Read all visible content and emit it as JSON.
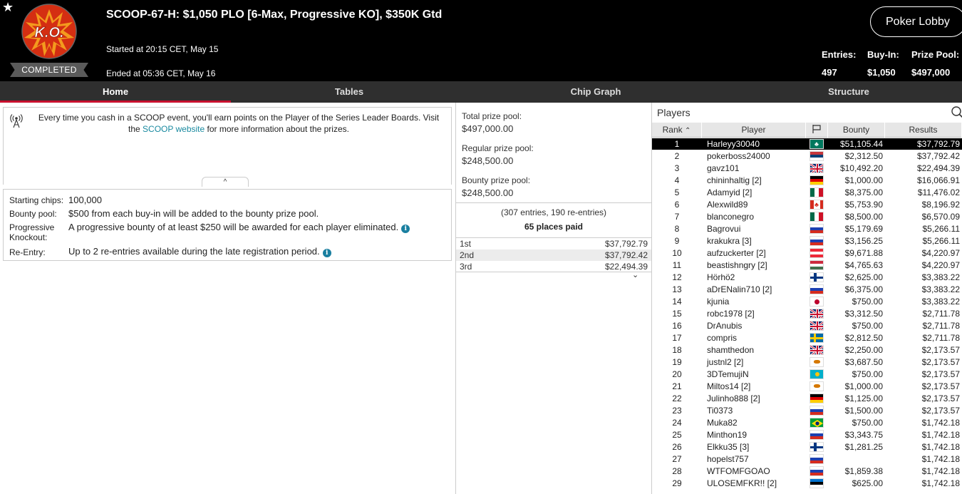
{
  "header": {
    "logo_text": "K.O.",
    "status": "COMPLETED",
    "title": "SCOOP-67-H: $1,050 PLO [6-Max, Progressive KO], $350K Gtd",
    "started": "Started at 20:15 CET, May 15",
    "ended": "Ended at 05:36 CET, May 16",
    "lobby_button": "Poker Lobby",
    "stats": {
      "entries_label": "Entries:",
      "entries_value": "497",
      "buyin_label": "Buy-In:",
      "buyin_value": "$1,050",
      "prize_label": "Prize Pool:",
      "prize_value": "$497,000"
    }
  },
  "tabs": [
    {
      "label": "Home",
      "active": true
    },
    {
      "label": "Tables",
      "active": false
    },
    {
      "label": "Chip Graph",
      "active": false
    },
    {
      "label": "Structure",
      "active": false
    }
  ],
  "info": {
    "text_before": "Every time you cash in a SCOOP event, you'll earn points on the Player of the Series Leader Boards. Visit the",
    "link": "SCOOP website",
    "text_after": "for more information about the prizes.",
    "collapse_glyph": "^"
  },
  "details": {
    "starting_chips_label": "Starting chips:",
    "starting_chips_value": "100,000",
    "bounty_pool_label": "Bounty pool:",
    "bounty_pool_value": "$500 from each buy-in will be added to the bounty prize pool.",
    "pko_label_1": "Progressive",
    "pko_label_2": "Knockout:",
    "pko_value": "A progressive bounty of at least $250 will be awarded for each player eliminated.",
    "reentry_label": "Re-Entry:",
    "reentry_value": "Up to 2 re-entries available during the late registration period."
  },
  "prize": {
    "total_label": "Total prize pool:",
    "total_value": "$497,000.00",
    "regular_label": "Regular prize pool:",
    "regular_value": "$248,500.00",
    "bounty_label": "Bounty prize pool:",
    "bounty_value": "$248,500.00",
    "entries_note": "(307 entries, 190 re-entries)",
    "places_paid": "65 places paid",
    "payouts": [
      {
        "place": "1st",
        "amount": "$37,792.79"
      },
      {
        "place": "2nd",
        "amount": "$37,792.42"
      },
      {
        "place": "3rd",
        "amount": "$22,494.39"
      }
    ]
  },
  "players": {
    "title": "Players",
    "columns": {
      "rank": "Rank",
      "player": "Player",
      "bounty": "Bounty",
      "results": "Results"
    },
    "rows": [
      {
        "rank": "1",
        "name": "Harleyy30040",
        "flag": "macau",
        "bounty": "$51,105.44",
        "result": "$37,792.79"
      },
      {
        "rank": "2",
        "name": "pokerboss24000",
        "flag": "serbia",
        "bounty": "$2,312.50",
        "result": "$37,792.42"
      },
      {
        "rank": "3",
        "name": "gavz101",
        "flag": "uk",
        "bounty": "$10,492.20",
        "result": "$22,494.39"
      },
      {
        "rank": "4",
        "name": "chininhaltig [2]",
        "flag": "germany",
        "bounty": "$1,000.00",
        "result": "$16,066.91"
      },
      {
        "rank": "5",
        "name": "Adamyid [2]",
        "flag": "mexico",
        "bounty": "$8,375.00",
        "result": "$11,476.02"
      },
      {
        "rank": "6",
        "name": "Alexwild89",
        "flag": "canada",
        "bounty": "$5,753.90",
        "result": "$8,196.92"
      },
      {
        "rank": "7",
        "name": "blanconegro",
        "flag": "mexico",
        "bounty": "$8,500.00",
        "result": "$6,570.09"
      },
      {
        "rank": "8",
        "name": "Bagrovui",
        "flag": "russia",
        "bounty": "$5,179.69",
        "result": "$5,266.11"
      },
      {
        "rank": "9",
        "name": "krakukra [3]",
        "flag": "russia",
        "bounty": "$3,156.25",
        "result": "$5,266.11"
      },
      {
        "rank": "10",
        "name": "aufzuckerter [2]",
        "flag": "austria",
        "bounty": "$9,671.88",
        "result": "$4,220.97"
      },
      {
        "rank": "11",
        "name": "beastishngry [2]",
        "flag": "hungary",
        "bounty": "$4,765.63",
        "result": "$4,220.97"
      },
      {
        "rank": "12",
        "name": "Hörhö2",
        "flag": "finland",
        "bounty": "$2,625.00",
        "result": "$3,383.22"
      },
      {
        "rank": "13",
        "name": "aDrENalin710 [2]",
        "flag": "russia",
        "bounty": "$6,375.00",
        "result": "$3,383.22"
      },
      {
        "rank": "14",
        "name": "kjunia",
        "flag": "japan",
        "bounty": "$750.00",
        "result": "$3,383.22"
      },
      {
        "rank": "15",
        "name": "robc1978 [2]",
        "flag": "uk",
        "bounty": "$3,312.50",
        "result": "$2,711.78"
      },
      {
        "rank": "16",
        "name": "DrAnubis",
        "flag": "uk",
        "bounty": "$750.00",
        "result": "$2,711.78"
      },
      {
        "rank": "17",
        "name": "compris",
        "flag": "sweden",
        "bounty": "$2,812.50",
        "result": "$2,711.78"
      },
      {
        "rank": "18",
        "name": "shamthedon",
        "flag": "uk",
        "bounty": "$2,250.00",
        "result": "$2,173.57"
      },
      {
        "rank": "19",
        "name": "justnl2 [2]",
        "flag": "cyprus",
        "bounty": "$3,687.50",
        "result": "$2,173.57"
      },
      {
        "rank": "20",
        "name": "3DTemujiN",
        "flag": "kazakhstan",
        "bounty": "$750.00",
        "result": "$2,173.57"
      },
      {
        "rank": "21",
        "name": "Miltos14 [2]",
        "flag": "cyprus",
        "bounty": "$1,000.00",
        "result": "$2,173.57"
      },
      {
        "rank": "22",
        "name": "Julinho888 [2]",
        "flag": "germany",
        "bounty": "$1,125.00",
        "result": "$2,173.57"
      },
      {
        "rank": "23",
        "name": "Ti0373",
        "flag": "russia",
        "bounty": "$1,500.00",
        "result": "$2,173.57"
      },
      {
        "rank": "24",
        "name": "Muka82",
        "flag": "brazil",
        "bounty": "$750.00",
        "result": "$1,742.18"
      },
      {
        "rank": "25",
        "name": "Minthon19",
        "flag": "russia",
        "bounty": "$3,343.75",
        "result": "$1,742.18"
      },
      {
        "rank": "26",
        "name": "Elkku35 [3]",
        "flag": "finland",
        "bounty": "$1,281.25",
        "result": "$1,742.18"
      },
      {
        "rank": "27",
        "name": "hopelst757",
        "flag": "russia",
        "bounty": "",
        "result": "$1,742.18"
      },
      {
        "rank": "28",
        "name": "WTFOMFGOAO",
        "flag": "russia",
        "bounty": "$1,859.38",
        "result": "$1,742.18"
      },
      {
        "rank": "29",
        "name": "ULOSEMFKR!! [2]",
        "flag": "estonia",
        "bounty": "$625.00",
        "result": "$1,742.18"
      }
    ]
  },
  "colors": {
    "header_bg": "#000000",
    "tab_bar_bg": "#2f2f2f",
    "tab_active_underline": "#c8102e",
    "link": "#1a8aa0",
    "info_icon": "#1a7fa0",
    "selected_row_bg": "#000000",
    "ko_badge_red": "#d42e12",
    "ko_badge_orange": "#f39a1e"
  },
  "icons": [
    "star-icon",
    "ko-logo",
    "antenna-icon",
    "info-icon",
    "search-icon",
    "flag-column-icon",
    "sort-ascending-icon",
    "chevron-up-icon",
    "chevron-down-icon"
  ]
}
